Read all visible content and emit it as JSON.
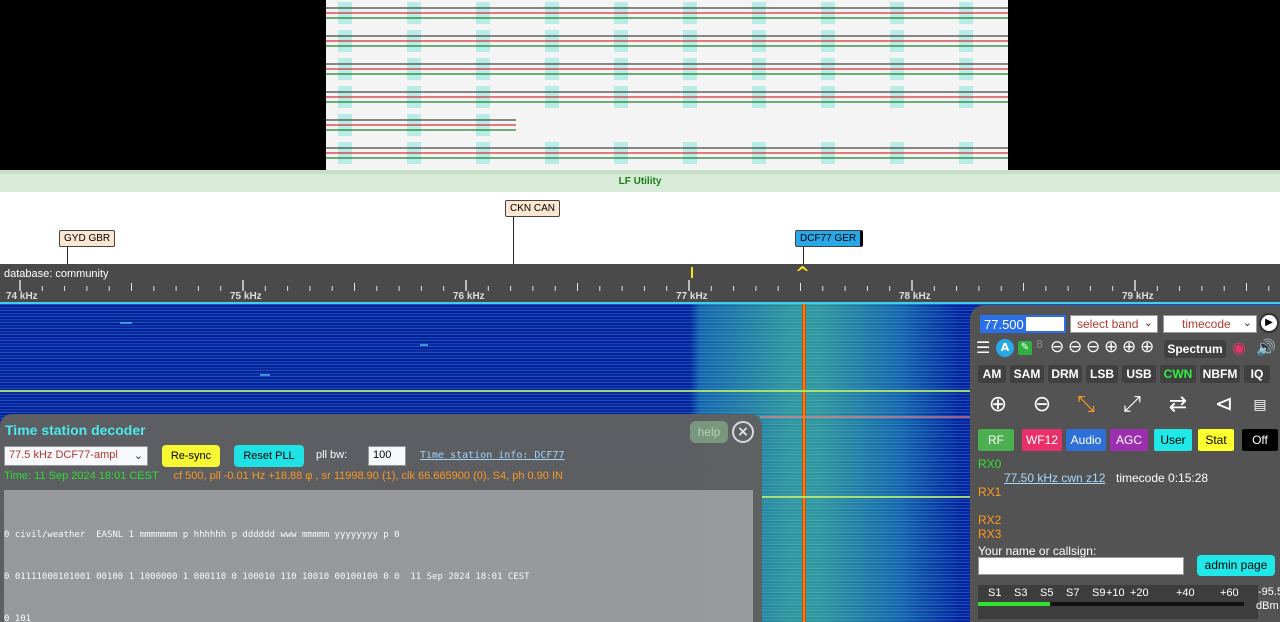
{
  "band": {
    "label": "LF Utility"
  },
  "stations": [
    {
      "label": "GYD GBR"
    },
    {
      "label": "CKN CAN"
    },
    {
      "label": "DCF77 GER"
    }
  ],
  "scale": {
    "database_label": "database: community",
    "ticks": [
      "74 kHz",
      "75 kHz",
      "76 kHz",
      "77 kHz",
      "78 kHz",
      "79 kHz"
    ],
    "passband_marker": "^"
  },
  "decoder": {
    "title": "Time station decoder",
    "help_label": "help",
    "close_icon": "×",
    "station_select": "77.5 kHz DCF77-ampl",
    "resync_label": "Re-sync",
    "reset_pll_label": "Reset PLL",
    "pll_bw_label": "pll bw:",
    "pll_bw_value": "100",
    "info_link": "Time station info: DCF77",
    "status_time": "Time: 11 Sep 2024 18:01 CEST",
    "status_params": "cf 500, pll -0.01 Hz +18.88 φ , sr 11998.90 (1), clk 66.665900 (0), S4, ph 0.90 IN",
    "output_lines": [
      "0 civil/weather  EASNL 1 mmmmmmm p hhhhhh p dddddd www mmmmm yyyyyyyy p 0",
      "0 01111000101001 00100 1 1000000 1 000110 0 100010 110 10010 00100100 0 0  11 Sep 2024 18:01 CEST",
      "0 101"
    ]
  },
  "control": {
    "frequency": "77.500",
    "band_select": "select band",
    "ext_select": "timecode",
    "spectrum_label": "Spectrum",
    "modes": [
      {
        "label": "AM",
        "active": false
      },
      {
        "label": "SAM",
        "active": false
      },
      {
        "label": "DRM",
        "active": false
      },
      {
        "label": "LSB",
        "active": false
      },
      {
        "label": "USB",
        "active": false
      },
      {
        "label": "CWN",
        "active": true
      },
      {
        "label": "NBFM",
        "active": false
      },
      {
        "label": "IQ",
        "active": false
      }
    ],
    "tabs": [
      {
        "label": "RF",
        "bg": "#4caf50",
        "fg": "#ffffff"
      },
      {
        "label": "WF12",
        "bg": "#e8306a",
        "fg": "#ffffff"
      },
      {
        "label": "Audio",
        "bg": "#2f6fd8",
        "fg": "#ffffff"
      },
      {
        "label": "AGC",
        "bg": "#9c2fb0",
        "fg": "#ffffff"
      },
      {
        "label": "User",
        "bg": "#20e8e8",
        "fg": "#000000"
      },
      {
        "label": "Stat",
        "bg": "#ffff30",
        "fg": "#000000"
      },
      {
        "label": "Off",
        "bg": "#000000",
        "fg": "#ffffff"
      }
    ],
    "rx": [
      {
        "label": "RX0",
        "color": "#30e030"
      },
      {
        "label": "RX1",
        "color": "#ff9a20"
      },
      {
        "label": "RX2",
        "color": "#ff9a20"
      },
      {
        "label": "RX3",
        "color": "#ff9a20"
      }
    ],
    "rx0_link": "77.50 kHz cwn z12",
    "rx0_info": "timecode 0:15:28",
    "name_label": "Your name or callsign:",
    "name_value": "",
    "admin_label": "admin page",
    "smeter_labels": [
      "S1",
      "S3",
      "S5",
      "S7",
      "S9",
      "+10",
      "+20",
      "+40",
      "+60"
    ],
    "dbm_value": "-95.5",
    "dbm_unit": "dBm",
    "smeter_level": 0.27
  }
}
